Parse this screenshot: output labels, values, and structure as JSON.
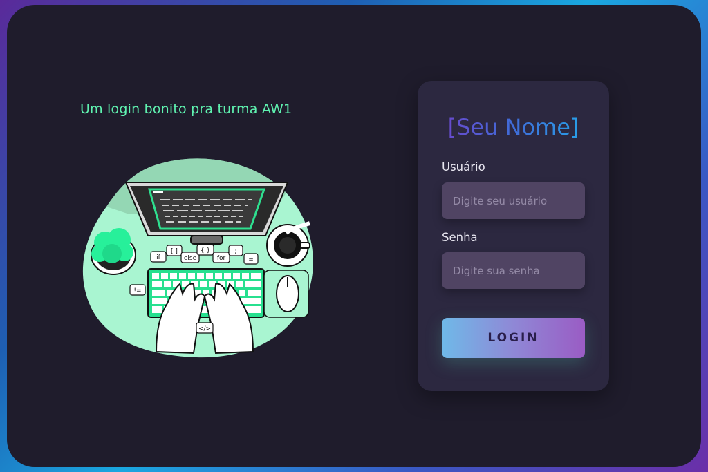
{
  "tagline": "Um login bonito pra turma AW1",
  "illustration": {
    "keys": [
      "if",
      "[ ]",
      "else",
      "{ }",
      "for",
      ";",
      "=",
      "!=",
      "</>"
    ]
  },
  "form": {
    "title": "[Seu Nome]",
    "username": {
      "label": "Usuário",
      "placeholder": "Digite seu usuário",
      "value": ""
    },
    "password": {
      "label": "Senha",
      "placeholder": "Digite sua senha",
      "value": ""
    },
    "submit_label": "LOGIN"
  },
  "colors": {
    "accent_green": "#5ff2b0",
    "panel_bg": "#1f1c2c",
    "card_bg": "#2c2840",
    "input_bg": "#504463"
  }
}
